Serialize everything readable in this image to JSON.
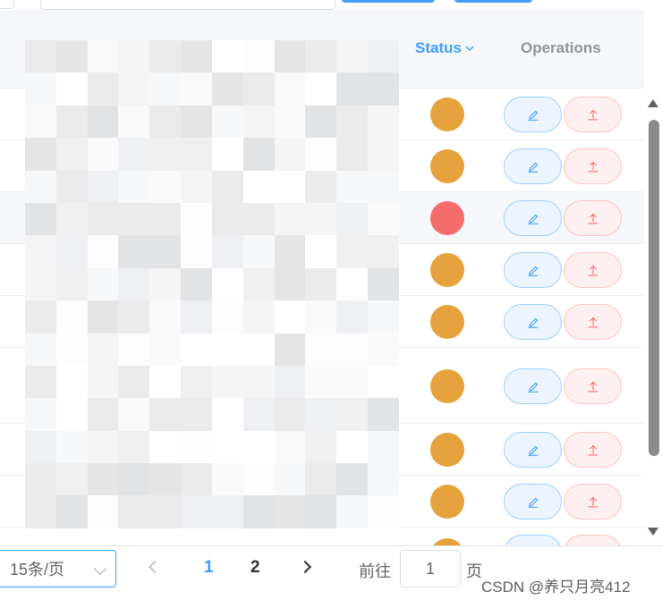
{
  "table": {
    "columns": [
      {
        "label": "Status",
        "sortable": true
      },
      {
        "label": "Operations"
      }
    ],
    "status_colors": {
      "warning": "#e6a23c",
      "danger": "#f56c6c"
    },
    "rows": [
      {
        "status": "warning"
      },
      {
        "status": "warning"
      },
      {
        "status": "danger",
        "highlighted": true
      },
      {
        "status": "warning"
      },
      {
        "status": "warning"
      },
      {
        "status": "warning"
      },
      {
        "status": "warning"
      },
      {
        "status": "warning"
      }
    ],
    "row_actions": [
      {
        "name": "edit",
        "icon": "edit-icon",
        "color": "#409eff"
      },
      {
        "name": "upload",
        "icon": "upload-icon",
        "color": "#f56c6c"
      }
    ],
    "redacted": true
  },
  "pagination": {
    "page_size": "15条/页",
    "pages": [
      "1",
      "2"
    ],
    "current_page": "1",
    "goto_label": "前往",
    "goto_value": "1",
    "goto_suffix": "页"
  },
  "watermark": "CSDN @养只月亮412",
  "accent": "#409eff"
}
